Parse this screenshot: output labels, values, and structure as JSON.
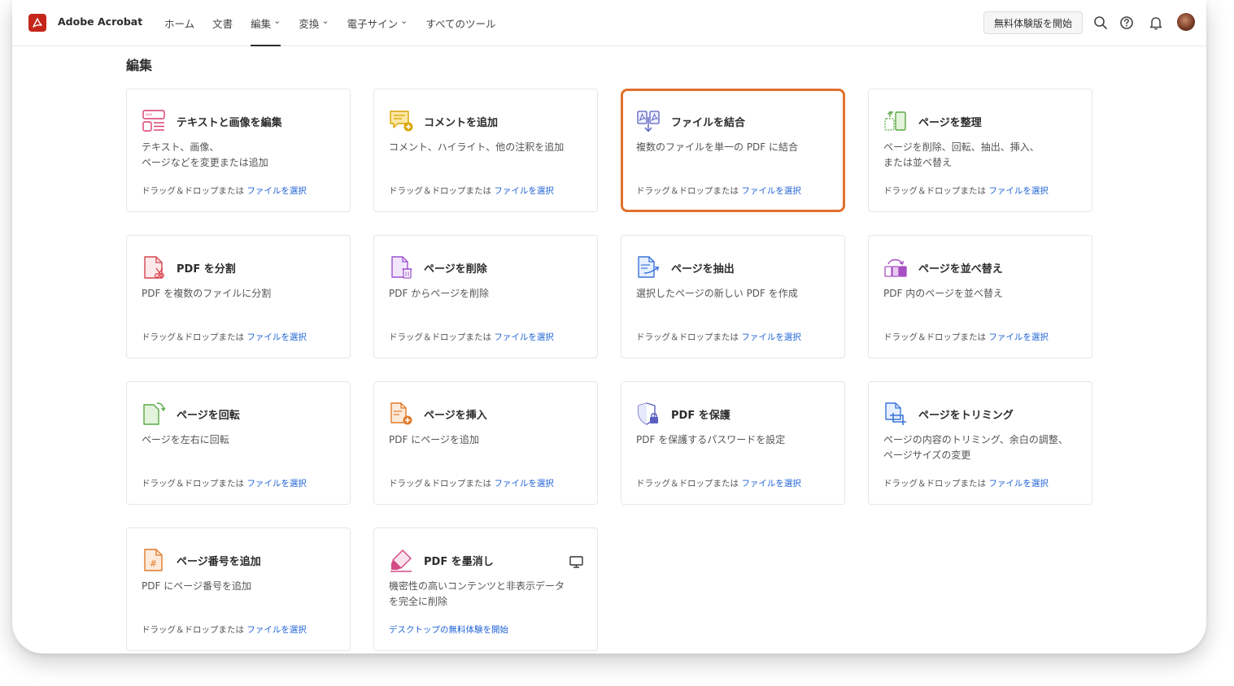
{
  "app": {
    "name": "Adobe Acrobat"
  },
  "nav": [
    {
      "label": "ホーム",
      "dropdown": false,
      "active": false
    },
    {
      "label": "文書",
      "dropdown": false,
      "active": false
    },
    {
      "label": "編集",
      "dropdown": true,
      "active": true
    },
    {
      "label": "変換",
      "dropdown": true,
      "active": false
    },
    {
      "label": "電子サイン",
      "dropdown": true,
      "active": false
    },
    {
      "label": "すべてのツール",
      "dropdown": false,
      "active": false
    }
  ],
  "header": {
    "trial_label": "無料体験版を開始",
    "icons": [
      "search-icon",
      "help-icon",
      "bell-icon",
      "avatar"
    ]
  },
  "section": {
    "title": "編集"
  },
  "common": {
    "drop_text": "ドラッグ＆ドロップまたは ",
    "select_link": "ファイルを選択"
  },
  "colors": {
    "accent_link": "#1f63d6",
    "selected_border": "#e0712d",
    "brand": "#c4261c"
  },
  "tools": [
    {
      "title": "テキストと画像を編集",
      "desc": "テキスト、画像、\nページなどを変更または追加",
      "icon": "edit-text-image-icon"
    },
    {
      "title": "コメントを追加",
      "desc": "コメント、ハイライト、他の注釈を追加",
      "icon": "add-comment-icon"
    },
    {
      "title": "ファイルを結合",
      "desc": "複数のファイルを単一の PDF に結合",
      "icon": "combine-files-icon",
      "selected": true
    },
    {
      "title": "ページを整理",
      "desc": "ページを削除、回転、抽出、挿入、\nまたは並べ替え",
      "icon": "organize-pages-icon"
    },
    {
      "title": "PDF を分割",
      "desc": "PDF を複数のファイルに分割",
      "icon": "split-pdf-icon"
    },
    {
      "title": "ページを削除",
      "desc": "PDF からページを削除",
      "icon": "delete-pages-icon"
    },
    {
      "title": "ページを抽出",
      "desc": "選択したページの新しい PDF を作成",
      "icon": "extract-pages-icon"
    },
    {
      "title": "ページを並べ替え",
      "desc": "PDF 内のページを並べ替え",
      "icon": "reorder-pages-icon"
    },
    {
      "title": "ページを回転",
      "desc": "ページを左右に回転",
      "icon": "rotate-pages-icon"
    },
    {
      "title": "ページを挿入",
      "desc": "PDF にページを追加",
      "icon": "insert-pages-icon"
    },
    {
      "title": "PDF を保護",
      "desc": "PDF を保護するパスワードを設定",
      "icon": "protect-pdf-icon"
    },
    {
      "title": "ページをトリミング",
      "desc": "ページの内容のトリミング、余白の調整、\nページサイズの変更",
      "icon": "crop-pages-icon"
    },
    {
      "title": "ページ番号を追加",
      "desc": "PDF にページ番号を追加",
      "icon": "page-numbers-icon"
    },
    {
      "title": "PDF を墨消し",
      "desc": "機密性の高いコンテンツと非表示データ\nを完全に削除",
      "icon": "redact-pdf-icon",
      "desktop_link": "デスクトップの無料体験を開始",
      "badge_icon": "desktop-monitor-icon"
    }
  ]
}
